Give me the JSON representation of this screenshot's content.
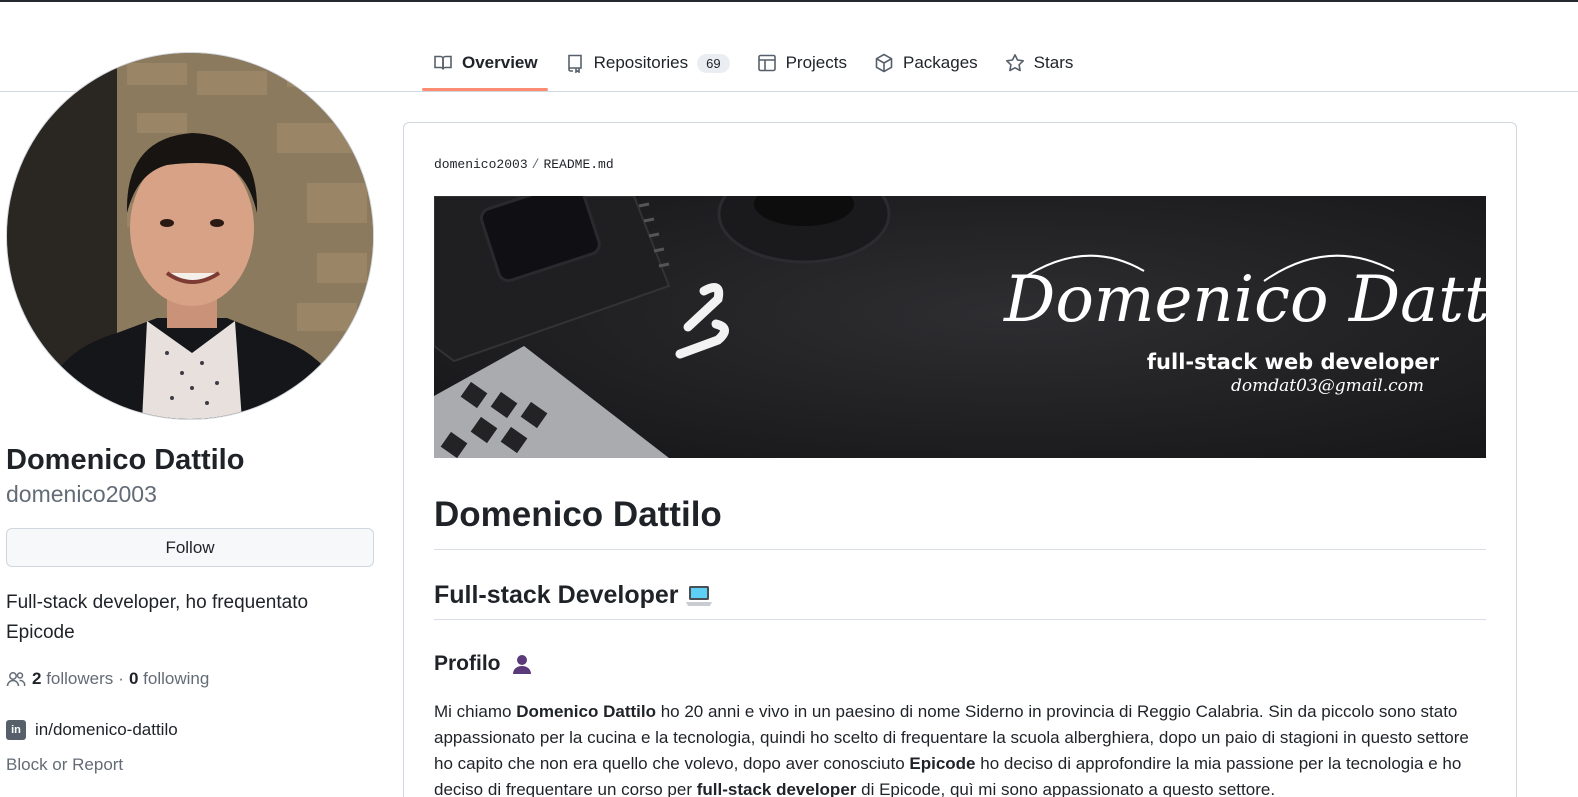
{
  "tabs": [
    {
      "label": "Overview",
      "icon": "book-icon",
      "selected": true
    },
    {
      "label": "Repositories",
      "icon": "repo-icon",
      "count": "69"
    },
    {
      "label": "Projects",
      "icon": "table-icon"
    },
    {
      "label": "Packages",
      "icon": "package-icon"
    },
    {
      "label": "Stars",
      "icon": "star-icon"
    }
  ],
  "profile": {
    "name": "Domenico Dattilo",
    "username": "domenico2003",
    "follow_label": "Follow",
    "bio": "Full-stack developer, ho frequentato Epicode",
    "followers_count": "2",
    "followers_label": "followers",
    "dot": "·",
    "following_count": "0",
    "following_label": "following",
    "linkedin": "in/domenico-dattilo",
    "block_report": "Block or Report"
  },
  "readme": {
    "owner": "domenico2003",
    "separator": "/",
    "file": "README.md",
    "banner": {
      "signature": "Domenico Dattilo",
      "role": "full-stack web developer",
      "email": "domdat03@gmail.com"
    },
    "h1": "Domenico Dattilo",
    "h2": "Full-stack Developer",
    "h3": "Profilo",
    "para": {
      "t1": "Mi chiamo ",
      "b1": "Domenico Dattilo",
      "t2": " ho 20 anni e vivo in un paesino di nome Siderno in provincia di Reggio Calabria. Sin da piccolo sono stato appassionato per la cucina e la tecnologia, quindi ho scelto di frequentare la scuola alberghiera, dopo un paio di stagioni in questo settore ho capito che non era quello che volevo, dopo aver conosciuto ",
      "b2": "Epicode",
      "t3": " ho deciso di approfondire la mia passione per la tecnologia e ho deciso di frequentare un corso per ",
      "b3": "full-stack developer",
      "t4": " di Epicode, quì mi sono appassionato a questo settore."
    }
  },
  "colors": {
    "tab_underline": "#fd8c73",
    "border": "#d0d7de",
    "muted": "#636c76",
    "text": "#1f2328"
  }
}
